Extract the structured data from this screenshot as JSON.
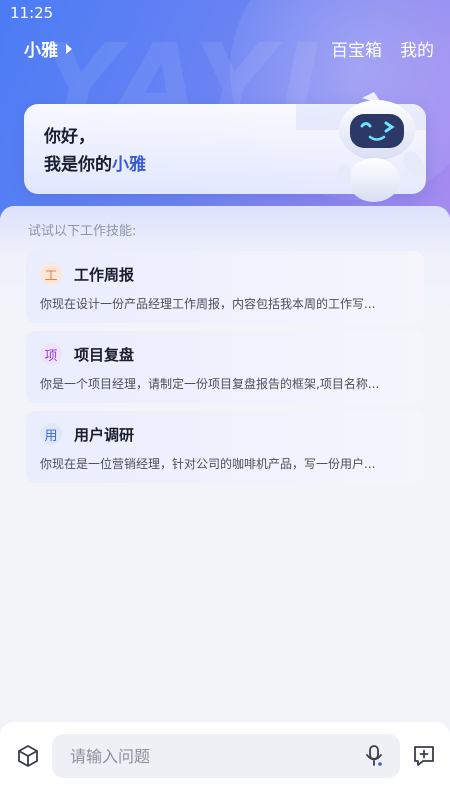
{
  "status": {
    "time": "11:25"
  },
  "header": {
    "assistant_name": "小雅",
    "nav": [
      "百宝箱",
      "我的"
    ]
  },
  "greeting": {
    "line1": "你好，",
    "line2_prefix": "我是你的",
    "line2_highlight": "小雅"
  },
  "skills": {
    "hint": "试试以下工作技能:",
    "items": [
      {
        "badge": "工",
        "badge_color": "#f07b3c",
        "badge_bg": "#fde7da",
        "title": "工作周报",
        "desc": "你现在设计一份产品经理工作周报，内容包括我本周的工作写..."
      },
      {
        "badge": "项",
        "badge_color": "#9b3fd6",
        "badge_bg": "#efe3fb",
        "title": "项目复盘",
        "desc": "你是一个项目经理，请制定一份项目复盘报告的框架,项目名称..."
      },
      {
        "badge": "用",
        "badge_color": "#3b6be0",
        "badge_bg": "#dfe7fb",
        "title": "用户调研",
        "desc": "你现在是一位营销经理，针对公司的咖啡机产品，写一份用户..."
      }
    ]
  },
  "input": {
    "placeholder": "请输入问题"
  },
  "colors": {
    "accent": "#3a5bd9",
    "hero_start": "#4a7cf5",
    "hero_end": "#a98cf0"
  }
}
